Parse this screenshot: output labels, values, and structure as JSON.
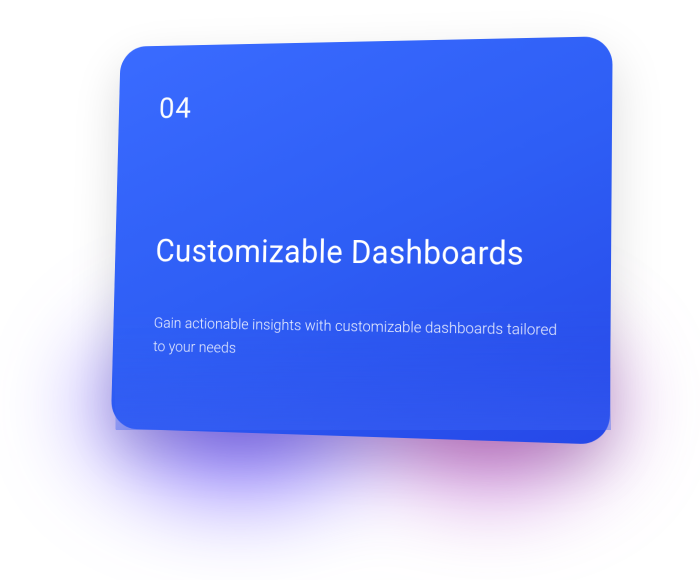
{
  "card": {
    "number": "04",
    "title": "Customizable Dashboards",
    "description": "Gain actionable insights with customizable dashboards tailored to your needs"
  },
  "colors": {
    "card_bg_start": "#3a6bff",
    "card_bg_end": "#2648e8",
    "glow_blue": "#583cff",
    "glow_magenta": "#c832b4"
  }
}
